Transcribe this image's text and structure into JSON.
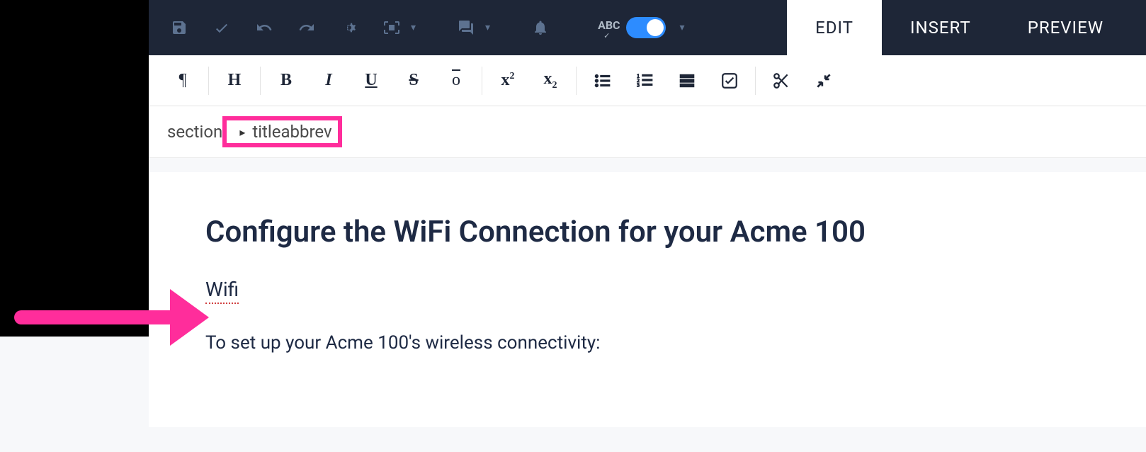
{
  "tabs": {
    "edit": "EDIT",
    "insert": "INSERT",
    "preview": "PREVIEW"
  },
  "spellcheck_label": "ABC",
  "breadcrumb": {
    "item1": "section",
    "item2": "titleabbrev"
  },
  "document": {
    "title": "Configure the WiFi Connection for your Acme 100",
    "titleabbrev": "Wifi",
    "body": "To set up your Acme 100's wireless connectivity:"
  },
  "format_labels": {
    "paragraph": "¶",
    "heading": "H",
    "bold": "B",
    "italic": "I",
    "underline": "U",
    "strike": "S",
    "overline": "o",
    "superscript_base": "x",
    "superscript_exp": "2",
    "subscript_base": "x",
    "subscript_exp": "2"
  }
}
